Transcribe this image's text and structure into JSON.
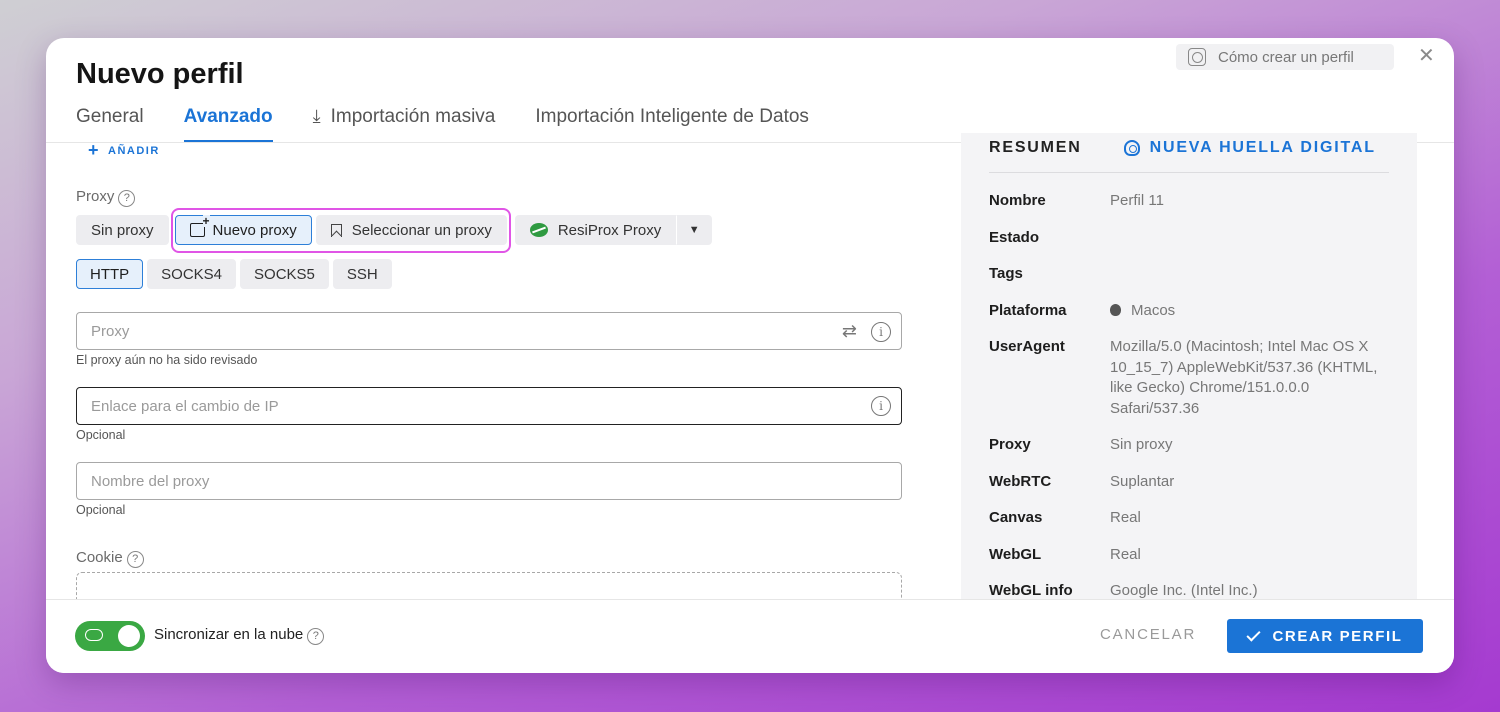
{
  "dialog": {
    "title": "Nuevo perfil",
    "howto_label": "Cómo crear un perfil",
    "close_symbol": "✕"
  },
  "tabs": [
    {
      "label": "General",
      "active": false
    },
    {
      "label": "Avanzado",
      "active": true
    },
    {
      "label": "Importación masiva",
      "active": false,
      "icon": "download-icon"
    },
    {
      "label": "Importación Inteligente de Datos",
      "active": false
    }
  ],
  "advanced": {
    "add_label": "AÑADIR",
    "proxy_label": "Proxy",
    "proxy_modes": [
      "Sin proxy",
      "Nuevo proxy",
      "Seleccionar un proxy",
      "ResiProx Proxy"
    ],
    "proxy_mode_selected": "Nuevo proxy",
    "protocols": [
      "HTTP",
      "SOCKS4",
      "SOCKS5",
      "SSH"
    ],
    "protocol_selected": "HTTP",
    "proxy_input": {
      "placeholder": "Proxy",
      "hint": "El proxy aún no ha sido revisado"
    },
    "ip_change_input": {
      "placeholder": "Enlace para el cambio de IP",
      "hint": "Opcional"
    },
    "proxy_name_input": {
      "placeholder": "Nombre del proxy",
      "hint": "Opcional"
    },
    "cookie_label": "Cookie"
  },
  "summary": {
    "title": "RESUMEN",
    "new_fingerprint": "NUEVA HUELLA DIGITAL",
    "rows": [
      {
        "key": "Nombre",
        "value": "Perfil 11"
      },
      {
        "key": "Estado",
        "value": ""
      },
      {
        "key": "Tags",
        "value": ""
      },
      {
        "key": "Plataforma",
        "value": "Macos",
        "icon": "apple-icon"
      },
      {
        "key": "UserAgent",
        "value": "Mozilla/5.0 (Macintosh; Intel Mac OS X 10_15_7) AppleWebKit/537.36 (KHTML, like Gecko) Chrome/151.0.0.0 Safari/537.36"
      },
      {
        "key": "Proxy",
        "value": "Sin proxy"
      },
      {
        "key": "WebRTC",
        "value": "Suplantar"
      },
      {
        "key": "Canvas",
        "value": "Real"
      },
      {
        "key": "WebGL",
        "value": "Real"
      },
      {
        "key": "WebGL info",
        "value": "Google Inc. (Intel Inc.)"
      }
    ]
  },
  "footer": {
    "sync_label": "Sincronizar en la nube",
    "sync_enabled": true,
    "cancel_label": "CANCELAR",
    "create_label": "CREAR PERFIL"
  },
  "colors": {
    "accent": "#1b74d6",
    "toggle_on": "#3aa843",
    "highlight": "#e055e6"
  }
}
